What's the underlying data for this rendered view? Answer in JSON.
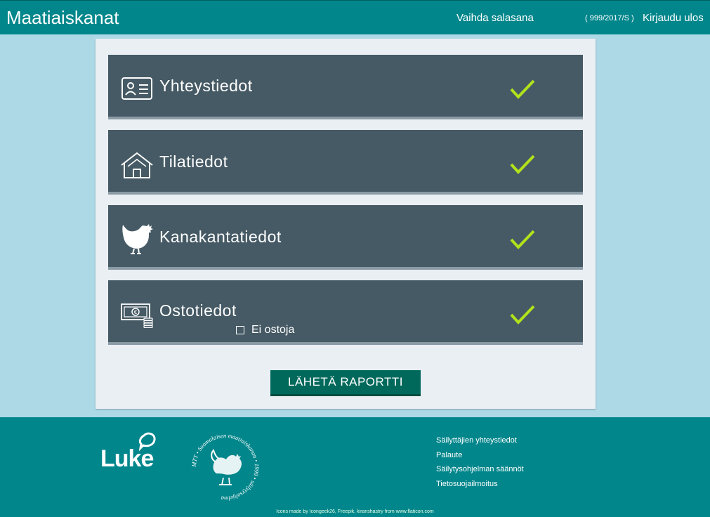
{
  "header": {
    "title": "Maatiaiskanat",
    "change_password": "Vaihda salasana",
    "user_id": "( 999/2017/S )",
    "logout": "Kirjaudu ulos"
  },
  "cards": [
    {
      "label": "Yhteystiedot",
      "icon": "contact-card-icon",
      "status": "checked"
    },
    {
      "label": "Tilatiedot",
      "icon": "farm-house-icon",
      "status": "checked"
    },
    {
      "label": "Kanakantatiedot",
      "icon": "rooster-icon",
      "status": "checked"
    },
    {
      "label": "Ostotiedot",
      "icon": "money-icon",
      "status": "checked"
    }
  ],
  "no_purchase": {
    "label": "Ei ostoja",
    "checked": false
  },
  "submit_label": "LÄHETÄ RAPORTTI",
  "footer": {
    "logo_text": "Luke",
    "seal_text": "MTT • Suomalaisen maatiaiskanan • 1998 • säilytysohjelma",
    "links": [
      "Säilyttäjien yhteystiedot",
      "Palaute",
      "Säilytysohjelman säännöt",
      "Tietosuojailmoitus"
    ],
    "credits": "Icons made by Icongeek26, Freepik, kiranshastry from www.flaticon.com"
  },
  "colors": {
    "header": "#00868b",
    "card": "#465a65",
    "check": "#b2e21b",
    "button": "#00695c",
    "background": "#add8e6"
  }
}
